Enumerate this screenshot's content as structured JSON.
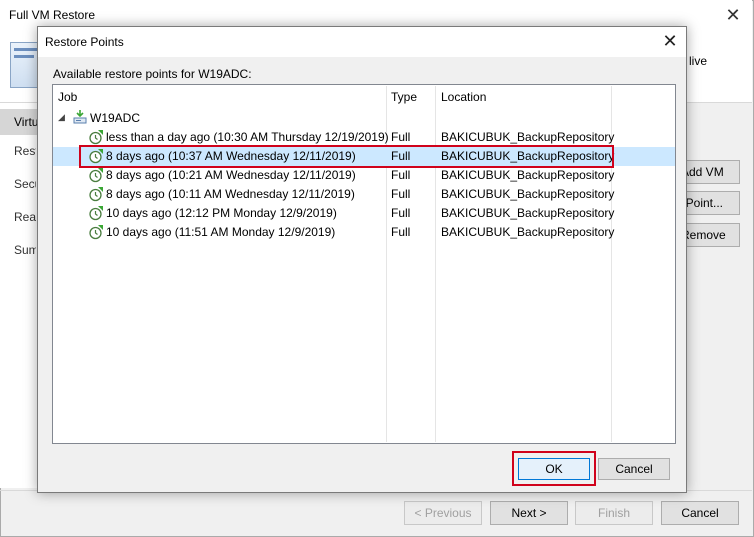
{
  "wizard": {
    "title": "Full VM Restore",
    "close_glyph": "✕",
    "header_desc": "live",
    "nav_items": [
      "Virtu",
      "Rest",
      "Secu",
      "Reas",
      "Sum"
    ],
    "side_buttons": {
      "add_vm": "Add VM",
      "point": "Point...",
      "remove": "Remove"
    },
    "footer_buttons": {
      "previous": "< Previous",
      "next": "Next >",
      "finish": "Finish",
      "cancel": "Cancel"
    }
  },
  "dialog": {
    "title": "Restore Points",
    "close_glyph": "✕",
    "caption": "Available restore points for W19ADC:",
    "columns": {
      "job": "Job",
      "type": "Type",
      "location": "Location"
    },
    "tree_root": {
      "label": "W19ADC",
      "expanded_glyph": "◢"
    },
    "restore_points": [
      {
        "date": "less than a day ago (10:30 AM Thursday 12/19/2019)",
        "type": "Full",
        "location": "BAKICUBUK_BackupRepository",
        "selected": false
      },
      {
        "date": "8 days ago (10:37 AM Wednesday 12/11/2019)",
        "type": "Full",
        "location": "BAKICUBUK_BackupRepository",
        "selected": true
      },
      {
        "date": "8 days ago (10:21 AM Wednesday 12/11/2019)",
        "type": "Full",
        "location": "BAKICUBUK_BackupRepository",
        "selected": false
      },
      {
        "date": "8 days ago (10:11 AM Wednesday 12/11/2019)",
        "type": "Full",
        "location": "BAKICUBUK_BackupRepository",
        "selected": false
      },
      {
        "date": "10 days ago (12:12 PM Monday 12/9/2019)",
        "type": "Full",
        "location": "BAKICUBUK_BackupRepository",
        "selected": false
      },
      {
        "date": "10 days ago (11:51 AM Monday 12/9/2019)",
        "type": "Full",
        "location": "BAKICUBUK_BackupRepository",
        "selected": false
      }
    ],
    "buttons": {
      "ok": "OK",
      "cancel": "Cancel"
    }
  },
  "icons": {
    "restore_point": "restore-point-clock-icon",
    "vm": "vm-server-icon"
  },
  "colors": {
    "selection": "#cce8ff",
    "highlight": "#d0021b",
    "accent": "#0078d7",
    "icon_green": "#3aa635"
  }
}
